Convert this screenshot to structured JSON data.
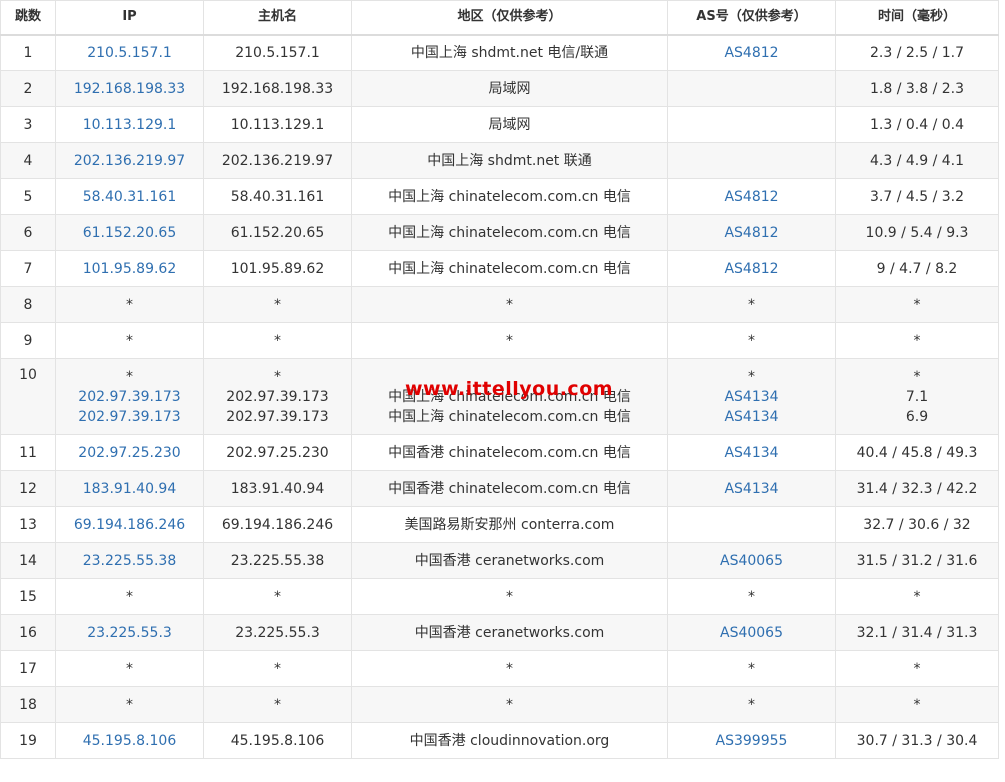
{
  "headers": {
    "hop": "跳数",
    "ip": "IP",
    "host": "主机名",
    "region": "地区（仅供参考）",
    "as": "AS号（仅供参考）",
    "time": "时间（毫秒）"
  },
  "watermark": "www.ittellyou.com",
  "rows": [
    {
      "hop": "1",
      "ip": [
        "210.5.157.1"
      ],
      "host": [
        "210.5.157.1"
      ],
      "region": [
        "中国上海 shdmt.net 电信/联通"
      ],
      "as": [
        "AS4812"
      ],
      "time": [
        "2.3 / 2.5 / 1.7"
      ]
    },
    {
      "hop": "2",
      "ip": [
        "192.168.198.33"
      ],
      "host": [
        "192.168.198.33"
      ],
      "region": [
        "局域网"
      ],
      "as": [
        ""
      ],
      "time": [
        "1.8 / 3.8 / 2.3"
      ]
    },
    {
      "hop": "3",
      "ip": [
        "10.113.129.1"
      ],
      "host": [
        "10.113.129.1"
      ],
      "region": [
        "局域网"
      ],
      "as": [
        ""
      ],
      "time": [
        "1.3 / 0.4 / 0.4"
      ]
    },
    {
      "hop": "4",
      "ip": [
        "202.136.219.97"
      ],
      "host": [
        "202.136.219.97"
      ],
      "region": [
        "中国上海 shdmt.net 联通"
      ],
      "as": [
        ""
      ],
      "time": [
        "4.3 / 4.9 / 4.1"
      ]
    },
    {
      "hop": "5",
      "ip": [
        "58.40.31.161"
      ],
      "host": [
        "58.40.31.161"
      ],
      "region": [
        "中国上海 chinatelecom.com.cn 电信"
      ],
      "as": [
        "AS4812"
      ],
      "time": [
        "3.7 / 4.5 / 3.2"
      ]
    },
    {
      "hop": "6",
      "ip": [
        "61.152.20.65"
      ],
      "host": [
        "61.152.20.65"
      ],
      "region": [
        "中国上海 chinatelecom.com.cn 电信"
      ],
      "as": [
        "AS4812"
      ],
      "time": [
        "10.9 / 5.4 / 9.3"
      ]
    },
    {
      "hop": "7",
      "ip": [
        "101.95.89.62"
      ],
      "host": [
        "101.95.89.62"
      ],
      "region": [
        "中国上海 chinatelecom.com.cn 电信"
      ],
      "as": [
        "AS4812"
      ],
      "time": [
        "9 / 4.7 / 8.2"
      ]
    },
    {
      "hop": "8",
      "ip": [
        "*"
      ],
      "host": [
        "*"
      ],
      "region": [
        "*"
      ],
      "as": [
        "*"
      ],
      "time": [
        "*"
      ]
    },
    {
      "hop": "9",
      "ip": [
        "*"
      ],
      "host": [
        "*"
      ],
      "region": [
        "*"
      ],
      "as": [
        "*"
      ],
      "time": [
        "*"
      ]
    },
    {
      "hop": "10",
      "ip": [
        "*",
        "202.97.39.173",
        "202.97.39.173"
      ],
      "host": [
        "*",
        "202.97.39.173",
        "202.97.39.173"
      ],
      "region": [
        "",
        "中国上海 chinatelecom.com.cn 电信",
        "中国上海 chinatelecom.com.cn 电信"
      ],
      "as": [
        "*",
        "AS4134",
        "AS4134"
      ],
      "time": [
        "*",
        "7.1",
        "6.9"
      ]
    },
    {
      "hop": "11",
      "ip": [
        "202.97.25.230"
      ],
      "host": [
        "202.97.25.230"
      ],
      "region": [
        "中国香港 chinatelecom.com.cn 电信"
      ],
      "as": [
        "AS4134"
      ],
      "time": [
        "40.4 / 45.8 / 49.3"
      ]
    },
    {
      "hop": "12",
      "ip": [
        "183.91.40.94"
      ],
      "host": [
        "183.91.40.94"
      ],
      "region": [
        "中国香港 chinatelecom.com.cn 电信"
      ],
      "as": [
        "AS4134"
      ],
      "time": [
        "31.4 / 32.3 / 42.2"
      ]
    },
    {
      "hop": "13",
      "ip": [
        "69.194.186.246"
      ],
      "host": [
        "69.194.186.246"
      ],
      "region": [
        "美国路易斯安那州 conterra.com"
      ],
      "as": [
        ""
      ],
      "time": [
        "32.7 / 30.6 / 32"
      ]
    },
    {
      "hop": "14",
      "ip": [
        "23.225.55.38"
      ],
      "host": [
        "23.225.55.38"
      ],
      "region": [
        "中国香港 ceranetworks.com"
      ],
      "as": [
        "AS40065"
      ],
      "time": [
        "31.5 / 31.2 / 31.6"
      ]
    },
    {
      "hop": "15",
      "ip": [
        "*"
      ],
      "host": [
        "*"
      ],
      "region": [
        "*"
      ],
      "as": [
        "*"
      ],
      "time": [
        "*"
      ]
    },
    {
      "hop": "16",
      "ip": [
        "23.225.55.3"
      ],
      "host": [
        "23.225.55.3"
      ],
      "region": [
        "中国香港 ceranetworks.com"
      ],
      "as": [
        "AS40065"
      ],
      "time": [
        "32.1 / 31.4 / 31.3"
      ]
    },
    {
      "hop": "17",
      "ip": [
        "*"
      ],
      "host": [
        "*"
      ],
      "region": [
        "*"
      ],
      "as": [
        "*"
      ],
      "time": [
        "*"
      ]
    },
    {
      "hop": "18",
      "ip": [
        "*"
      ],
      "host": [
        "*"
      ],
      "region": [
        "*"
      ],
      "as": [
        "*"
      ],
      "time": [
        "*"
      ]
    },
    {
      "hop": "19",
      "ip": [
        "45.195.8.106"
      ],
      "host": [
        "45.195.8.106"
      ],
      "region": [
        "中国香港 cloudinnovation.org"
      ],
      "as": [
        "AS399955"
      ],
      "time": [
        "30.7 / 31.3 / 30.4"
      ]
    }
  ]
}
